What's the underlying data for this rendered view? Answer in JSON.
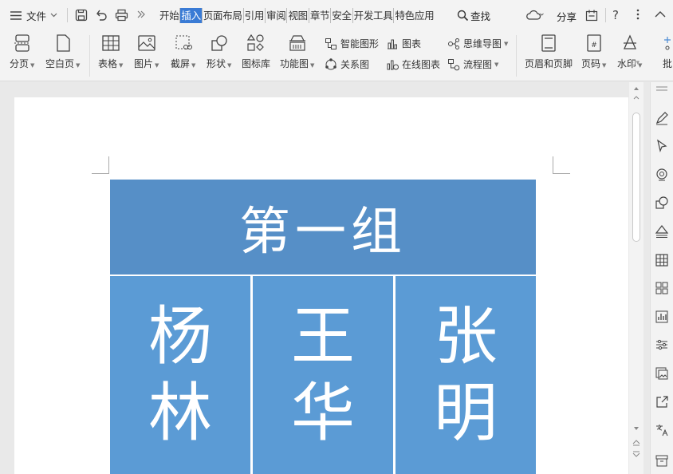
{
  "menu": {
    "file_label": "文件",
    "tabs": [
      {
        "label": "开始",
        "active": false
      },
      {
        "label": "插入",
        "active": true
      },
      {
        "label": "页面布局",
        "active": false
      },
      {
        "label": "引用",
        "active": false
      },
      {
        "label": "审阅",
        "active": false
      },
      {
        "label": "视图",
        "active": false
      },
      {
        "label": "章节",
        "active": false
      },
      {
        "label": "安全",
        "active": false
      },
      {
        "label": "开发工具",
        "active": false
      },
      {
        "label": "特色应用",
        "active": false
      }
    ],
    "search_label": "查找",
    "share_label": "分享"
  },
  "ribbon": {
    "page_break": "分页",
    "blank_page": "空白页",
    "table": "表格",
    "picture": "图片",
    "screenshot": "截屏",
    "shape": "形状",
    "icon_library": "图标库",
    "function_chart": "功能图",
    "smart_graphic": "智能图形",
    "chart": "图表",
    "mind_map": "思维导图",
    "relation_chart": "关系图",
    "online_chart": "在线图表",
    "flowchart": "流程图",
    "header_footer": "页眉和页脚",
    "page_number": "页码",
    "watermark": "水印",
    "cut_off": "批"
  },
  "document": {
    "table_header": "第一组",
    "members": [
      {
        "line1": "杨",
        "line2": "林"
      },
      {
        "line1": "王",
        "line2": "华"
      },
      {
        "line1": "张",
        "line2": "明"
      }
    ]
  },
  "colors": {
    "header_fill": "#568fc7",
    "cell_fill": "#5b9bd5",
    "active_tab": "#3a7bd5"
  }
}
